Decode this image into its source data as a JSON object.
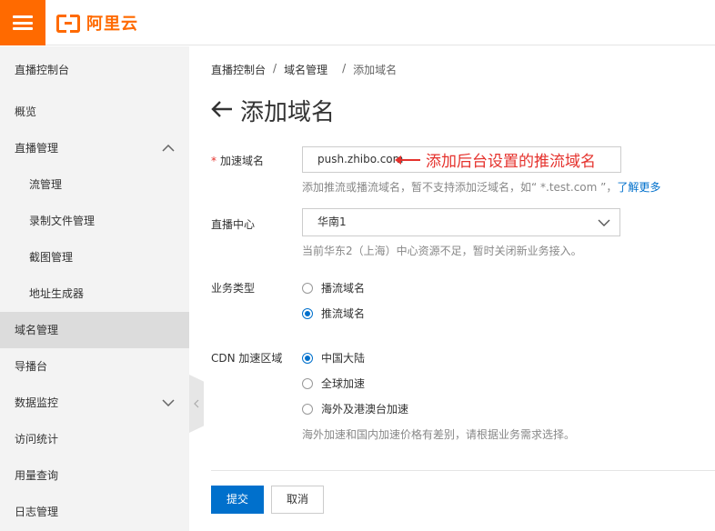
{
  "header": {
    "logo_text": "阿里云",
    "brand_color": "#ff6a00"
  },
  "sidebar": {
    "items": [
      {
        "label": "直播控制台",
        "level": 1
      },
      {
        "label": "概览",
        "level": 1
      },
      {
        "label": "直播管理",
        "level": 1,
        "expanded": true
      },
      {
        "label": "流管理",
        "level": 2
      },
      {
        "label": "录制文件管理",
        "level": 2
      },
      {
        "label": "截图管理",
        "level": 2
      },
      {
        "label": "地址生成器",
        "level": 2
      },
      {
        "label": "域名管理",
        "level": 1,
        "active": true
      },
      {
        "label": "导播台",
        "level": 1
      },
      {
        "label": "数据监控",
        "level": 1,
        "expanded": false
      },
      {
        "label": "访问统计",
        "level": 1
      },
      {
        "label": "用量查询",
        "level": 1
      },
      {
        "label": "日志管理",
        "level": 1
      }
    ]
  },
  "breadcrumb": {
    "items": [
      "直播控制台",
      "域名管理",
      "添加域名"
    ],
    "separator": "/"
  },
  "page": {
    "title": "添加域名"
  },
  "form": {
    "domain": {
      "required_mark": "*",
      "label": "加速域名",
      "value": "push.zhibo.com",
      "hint": "添加推流或播流域名，暂不支持添加泛域名，如“ *.test.com ”，",
      "hint_link": "了解更多"
    },
    "annotation": "添加后台设置的推流域名",
    "center": {
      "label": "直播中心",
      "value": "华南1",
      "hint": "当前华东2（上海）中心资源不足，暂时关闭新业务接入。"
    },
    "business_type": {
      "label": "业务类型",
      "options": [
        "播流域名",
        "推流域名"
      ],
      "selected": "推流域名"
    },
    "cdn_region": {
      "label": "CDN 加速区域",
      "options": [
        "中国大陆",
        "全球加速",
        "海外及港澳台加速"
      ],
      "selected": "中国大陆",
      "hint": "海外加速和国内加速价格有差别，请根据业务需求选择。"
    },
    "submit_label": "提交",
    "cancel_label": "取消"
  },
  "colors": {
    "primary": "#0070cc",
    "annotation": "#e5322d",
    "sidebar_bg": "#f3f3f3",
    "sidebar_active_bg": "#dcdcdc"
  }
}
